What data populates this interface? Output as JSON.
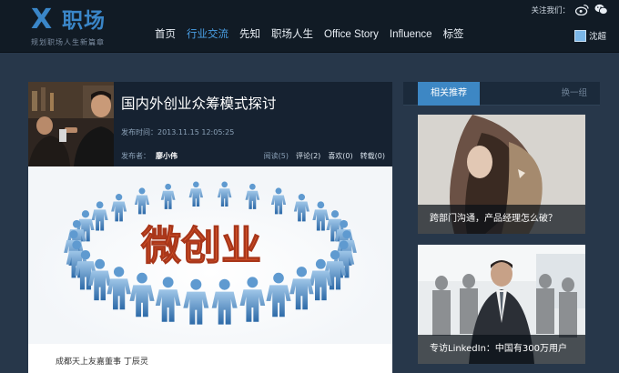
{
  "site": {
    "logo_mark": "X",
    "logo_text": "职场",
    "tagline": "规划职场人生新篇章"
  },
  "nav": {
    "items": [
      {
        "label": "首页",
        "active": false
      },
      {
        "label": "行业交流",
        "active": true
      },
      {
        "label": "先知",
        "active": false
      },
      {
        "label": "职场人生",
        "active": false
      },
      {
        "label": "Office Story",
        "active": false
      },
      {
        "label": "Influence",
        "active": false
      },
      {
        "label": "标签",
        "active": false
      }
    ]
  },
  "header": {
    "follow_label": "关注我们：",
    "follow_icons": [
      "weibo-icon",
      "wechat-icon"
    ],
    "user_name": "沈超"
  },
  "article": {
    "title": "国内外创业众筹模式探讨",
    "time_label": "发布时间：",
    "time": "2013.11.15 12:05:25",
    "publisher_label": "发布者：",
    "publisher": "廖小伟",
    "stats": {
      "reads": "阅读(5)",
      "comments": "评论(2)",
      "likes": "喜欢(0)",
      "shares": "转载(0)"
    },
    "hero_text": "微创业",
    "caption": "成都天上友嘉董事 丁辰灵"
  },
  "sidebar": {
    "tab_label": "相关推荐",
    "refresh_label": "换一组",
    "items": [
      {
        "title": "跨部门沟通，产品经理怎么破？"
      },
      {
        "title": "专访LinkedIn：中国有300万用户"
      }
    ]
  },
  "colors": {
    "accent": "#3d87c4",
    "nav_active": "#4aa0e6",
    "page_bg": "#27374a",
    "header_bg": "#111b25"
  }
}
